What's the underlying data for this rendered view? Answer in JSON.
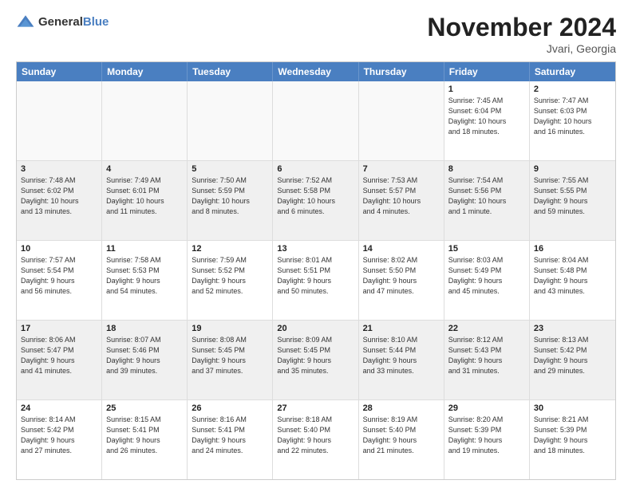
{
  "logo": {
    "general": "General",
    "blue": "Blue"
  },
  "title": "November 2024",
  "location": "Jvari, Georgia",
  "days_of_week": [
    "Sunday",
    "Monday",
    "Tuesday",
    "Wednesday",
    "Thursday",
    "Friday",
    "Saturday"
  ],
  "weeks": [
    [
      {
        "day": "",
        "info": ""
      },
      {
        "day": "",
        "info": ""
      },
      {
        "day": "",
        "info": ""
      },
      {
        "day": "",
        "info": ""
      },
      {
        "day": "",
        "info": ""
      },
      {
        "day": "1",
        "info": "Sunrise: 7:45 AM\nSunset: 6:04 PM\nDaylight: 10 hours\nand 18 minutes."
      },
      {
        "day": "2",
        "info": "Sunrise: 7:47 AM\nSunset: 6:03 PM\nDaylight: 10 hours\nand 16 minutes."
      }
    ],
    [
      {
        "day": "3",
        "info": "Sunrise: 7:48 AM\nSunset: 6:02 PM\nDaylight: 10 hours\nand 13 minutes."
      },
      {
        "day": "4",
        "info": "Sunrise: 7:49 AM\nSunset: 6:01 PM\nDaylight: 10 hours\nand 11 minutes."
      },
      {
        "day": "5",
        "info": "Sunrise: 7:50 AM\nSunset: 5:59 PM\nDaylight: 10 hours\nand 8 minutes."
      },
      {
        "day": "6",
        "info": "Sunrise: 7:52 AM\nSunset: 5:58 PM\nDaylight: 10 hours\nand 6 minutes."
      },
      {
        "day": "7",
        "info": "Sunrise: 7:53 AM\nSunset: 5:57 PM\nDaylight: 10 hours\nand 4 minutes."
      },
      {
        "day": "8",
        "info": "Sunrise: 7:54 AM\nSunset: 5:56 PM\nDaylight: 10 hours\nand 1 minute."
      },
      {
        "day": "9",
        "info": "Sunrise: 7:55 AM\nSunset: 5:55 PM\nDaylight: 9 hours\nand 59 minutes."
      }
    ],
    [
      {
        "day": "10",
        "info": "Sunrise: 7:57 AM\nSunset: 5:54 PM\nDaylight: 9 hours\nand 56 minutes."
      },
      {
        "day": "11",
        "info": "Sunrise: 7:58 AM\nSunset: 5:53 PM\nDaylight: 9 hours\nand 54 minutes."
      },
      {
        "day": "12",
        "info": "Sunrise: 7:59 AM\nSunset: 5:52 PM\nDaylight: 9 hours\nand 52 minutes."
      },
      {
        "day": "13",
        "info": "Sunrise: 8:01 AM\nSunset: 5:51 PM\nDaylight: 9 hours\nand 50 minutes."
      },
      {
        "day": "14",
        "info": "Sunrise: 8:02 AM\nSunset: 5:50 PM\nDaylight: 9 hours\nand 47 minutes."
      },
      {
        "day": "15",
        "info": "Sunrise: 8:03 AM\nSunset: 5:49 PM\nDaylight: 9 hours\nand 45 minutes."
      },
      {
        "day": "16",
        "info": "Sunrise: 8:04 AM\nSunset: 5:48 PM\nDaylight: 9 hours\nand 43 minutes."
      }
    ],
    [
      {
        "day": "17",
        "info": "Sunrise: 8:06 AM\nSunset: 5:47 PM\nDaylight: 9 hours\nand 41 minutes."
      },
      {
        "day": "18",
        "info": "Sunrise: 8:07 AM\nSunset: 5:46 PM\nDaylight: 9 hours\nand 39 minutes."
      },
      {
        "day": "19",
        "info": "Sunrise: 8:08 AM\nSunset: 5:45 PM\nDaylight: 9 hours\nand 37 minutes."
      },
      {
        "day": "20",
        "info": "Sunrise: 8:09 AM\nSunset: 5:45 PM\nDaylight: 9 hours\nand 35 minutes."
      },
      {
        "day": "21",
        "info": "Sunrise: 8:10 AM\nSunset: 5:44 PM\nDaylight: 9 hours\nand 33 minutes."
      },
      {
        "day": "22",
        "info": "Sunrise: 8:12 AM\nSunset: 5:43 PM\nDaylight: 9 hours\nand 31 minutes."
      },
      {
        "day": "23",
        "info": "Sunrise: 8:13 AM\nSunset: 5:42 PM\nDaylight: 9 hours\nand 29 minutes."
      }
    ],
    [
      {
        "day": "24",
        "info": "Sunrise: 8:14 AM\nSunset: 5:42 PM\nDaylight: 9 hours\nand 27 minutes."
      },
      {
        "day": "25",
        "info": "Sunrise: 8:15 AM\nSunset: 5:41 PM\nDaylight: 9 hours\nand 26 minutes."
      },
      {
        "day": "26",
        "info": "Sunrise: 8:16 AM\nSunset: 5:41 PM\nDaylight: 9 hours\nand 24 minutes."
      },
      {
        "day": "27",
        "info": "Sunrise: 8:18 AM\nSunset: 5:40 PM\nDaylight: 9 hours\nand 22 minutes."
      },
      {
        "day": "28",
        "info": "Sunrise: 8:19 AM\nSunset: 5:40 PM\nDaylight: 9 hours\nand 21 minutes."
      },
      {
        "day": "29",
        "info": "Sunrise: 8:20 AM\nSunset: 5:39 PM\nDaylight: 9 hours\nand 19 minutes."
      },
      {
        "day": "30",
        "info": "Sunrise: 8:21 AM\nSunset: 5:39 PM\nDaylight: 9 hours\nand 18 minutes."
      }
    ]
  ]
}
